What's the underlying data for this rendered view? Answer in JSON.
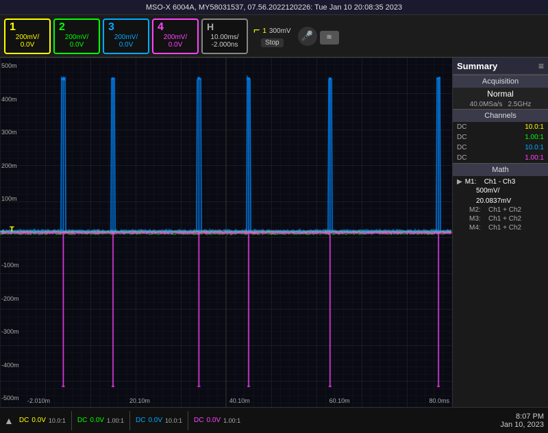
{
  "topbar": {
    "title": "MSO-X 6004A,  MY58031537,  07.56.2022120226:  Tue Jan 10 20:08:35 2023"
  },
  "toolbar": {
    "channels": [
      {
        "id": "1",
        "voltage": "200mV/",
        "offset": "0.0V",
        "color": "ch1"
      },
      {
        "id": "2",
        "voltage": "200mV/",
        "offset": "0.0V",
        "color": "ch2"
      },
      {
        "id": "3",
        "voltage": "200mV/",
        "offset": "0.0V",
        "color": "ch3"
      },
      {
        "id": "4",
        "voltage": "200mV/",
        "offset": "0.0V",
        "color": "ch4"
      }
    ],
    "horizontal": {
      "label": "H",
      "timebase": "10.00ms/",
      "delay": "-2.000ns"
    },
    "trigger": {
      "symbol": "⌐",
      "channel": "1",
      "level": "300mV",
      "mode": "Stop"
    }
  },
  "scope": {
    "y_labels": [
      "500m",
      "400m",
      "300m",
      "200m",
      "100m",
      "0",
      "-100m",
      "-200m",
      "-300m",
      "-400m",
      "-500m"
    ],
    "x_labels": [
      "-2.010m",
      "20.10m",
      "40.10m",
      "60.10m",
      "80.0ms"
    ]
  },
  "sidebar": {
    "title": "Summary",
    "icon": "≡",
    "acquisition": {
      "header": "Acquisition",
      "mode": "Normal",
      "sample_rate": "40.0MSa/s",
      "bandwidth": "2.5GHz"
    },
    "channels_header": "Channels",
    "channels": [
      {
        "coupling": "DC",
        "ratio": "10.0:1",
        "color": "ch-color-1"
      },
      {
        "coupling": "DC",
        "ratio": "1.00:1",
        "color": "ch-color-2"
      },
      {
        "coupling": "DC",
        "ratio": "10.0:1",
        "color": "ch-color-3"
      },
      {
        "coupling": "DC",
        "ratio": "1.00:1",
        "color": "ch-color-4"
      }
    ],
    "math_header": "Math",
    "math": [
      {
        "label": "M1:",
        "formula": "Ch1 - Ch3",
        "extra1": "500mV/",
        "extra2": "20.0837mV",
        "active": true,
        "arrow": "▶"
      },
      {
        "label": "M2:",
        "formula": "Ch1 + Ch2",
        "active": false
      },
      {
        "label": "M3:",
        "formula": "Ch1 + Ch2",
        "active": false
      },
      {
        "label": "M4:",
        "formula": "Ch1 + Ch2",
        "active": false
      }
    ]
  },
  "bottom_bar": {
    "channels": [
      {
        "coupling": "DC",
        "voltage": "0.0V",
        "ratio": "10.0:1",
        "color": "ch1"
      },
      {
        "coupling": "DC",
        "voltage": "0.0V",
        "ratio": "1.00:1",
        "color": "ch2"
      },
      {
        "coupling": "DC",
        "voltage": "0.0V",
        "ratio": "10.0:1",
        "color": "ch3"
      },
      {
        "coupling": "DC",
        "voltage": "0.0V",
        "ratio": "1.00:1",
        "color": "ch4"
      }
    ],
    "time": "8:07 PM",
    "date": "Jan 10, 2023"
  },
  "colors": {
    "ch1": "#ffff00",
    "ch2": "#00ff00",
    "ch3": "#00aaff",
    "ch4": "#ff44ff",
    "grid": "#1e2a1e",
    "bg": "#0a0a14"
  }
}
